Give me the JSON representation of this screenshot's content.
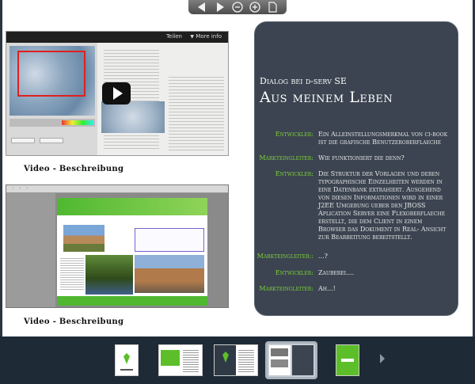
{
  "toolbar": {
    "buttons": [
      "previous-page",
      "next-page",
      "zoom-out",
      "zoom-in",
      "page-view"
    ]
  },
  "video1": {
    "share_label": "Teilen",
    "more_label": "More info",
    "caption": "Video - Beschreibung"
  },
  "video2": {
    "caption": "Video - Beschreibung"
  },
  "panel": {
    "kicker": "Dialog bei d-serv SE",
    "title": "Aus meinem Leben",
    "dialogue": [
      {
        "speaker": "Entwickler:",
        "text": "Ein Alleinstellungsmerkmal von ci-book ist die grafische Benutzeroberflaeche"
      },
      {
        "speaker": "Markteingleiter:",
        "text": "Wie funktioniert die denn?"
      },
      {
        "speaker": "Entwickler:",
        "text": "Die Struktur der Vorlagen und deren typographische Einzelheiten werden in eine Datenbank extrahiert. Ausgehend von diesen Informationen wird in einer J2EE Umgebung ueber den JBOSS Aplication Server eine Flexoberflaeche erstellt, die dem Client in einem Browser das Dokument in Real- Ansicht zur Bearbeitung bereitstellt."
      },
      {
        "speaker": "Markteingleiter::",
        "text": "...?"
      },
      {
        "speaker": "Entwickler:",
        "text": "Zauberei...."
      },
      {
        "speaker": "Markteingleiter:",
        "text": "Ah...!"
      }
    ]
  },
  "colors": {
    "panel_bg": "#3b4450",
    "speaker": "#7fd13a",
    "strip_bg": "#1e2a36"
  }
}
